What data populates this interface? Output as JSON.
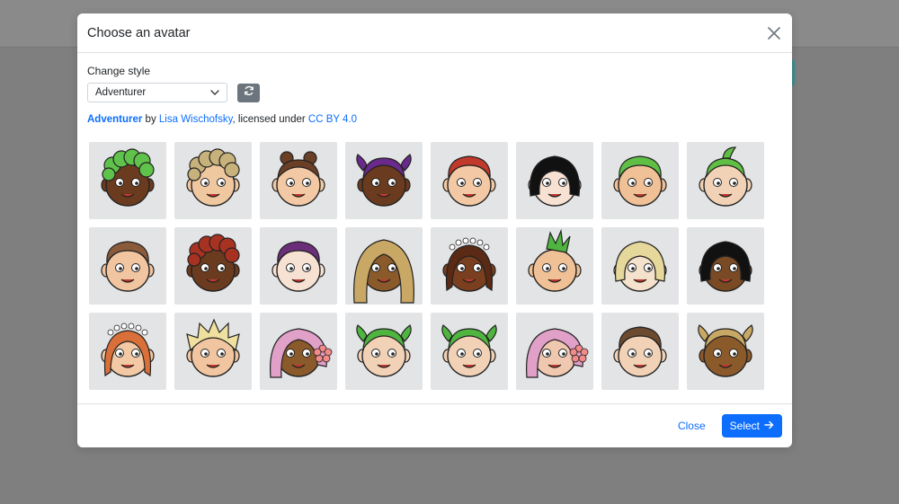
{
  "modal": {
    "title": "Choose an avatar",
    "change_style_label": "Change style",
    "style_select": {
      "selected": "Adventurer"
    },
    "credit": {
      "style_name": "Adventurer",
      "by_text": " by ",
      "author": "Lisa Wischofsky",
      "licensed_text": ", licensed under ",
      "license": "CC BY 4.0"
    },
    "footer": {
      "close_label": "Close",
      "select_label": "Select"
    }
  },
  "avatars": [
    {
      "skin": "#6b3b1f",
      "hair": "#5fc24a",
      "style": "curly"
    },
    {
      "skin": "#f0c8a0",
      "hair": "#c8b27c",
      "style": "curly"
    },
    {
      "skin": "#f2c9a4",
      "hair": "#6b3f26",
      "style": "buns"
    },
    {
      "skin": "#6b3b1f",
      "hair": "#6a2a8c",
      "style": "pigtails"
    },
    {
      "skin": "#f2c9a4",
      "hair": "#c0392b",
      "style": "short"
    },
    {
      "skin": "#f6e1d3",
      "hair": "#111111",
      "style": "bob"
    },
    {
      "skin": "#f0c096",
      "hair": "#5fbf45",
      "style": "short"
    },
    {
      "skin": "#f2d2b6",
      "hair": "#5fbf45",
      "style": "tuft"
    },
    {
      "skin": "#f0c59f",
      "hair": "#8a5a3b",
      "style": "short"
    },
    {
      "skin": "#6b3b1f",
      "hair": "#a83222",
      "style": "curly"
    },
    {
      "skin": "#f6e1d3",
      "hair": "#6b2f7a",
      "style": "short"
    },
    {
      "skin": "#8b5a2b",
      "hair": "#c9a865",
      "style": "long"
    },
    {
      "skin": "#7a3f1f",
      "hair": "#5a2a14",
      "style": "crown"
    },
    {
      "skin": "#f0c096",
      "hair": "#4fb540",
      "style": "mohawk"
    },
    {
      "skin": "#f4e2cc",
      "hair": "#e6d89a",
      "style": "bob"
    },
    {
      "skin": "#7a4a24",
      "hair": "#111111",
      "style": "bob"
    },
    {
      "skin": "#f2c9a4",
      "hair": "#d9703a",
      "style": "crown"
    },
    {
      "skin": "#f0c59f",
      "hair": "#efe0a0",
      "style": "spiky"
    },
    {
      "skin": "#8b5a2b",
      "hair": "#e0a0c8",
      "style": "flower"
    },
    {
      "skin": "#f2d2b6",
      "hair": "#4fb540",
      "style": "pigtails"
    },
    {
      "skin": "#f2d2b6",
      "hair": "#4fb540",
      "style": "pigtails"
    },
    {
      "skin": "#f0c8b0",
      "hair": "#e0a0c8",
      "style": "flower"
    },
    {
      "skin": "#f2d2b6",
      "hair": "#6b4a30",
      "style": "short"
    },
    {
      "skin": "#8b5a2b",
      "hair": "#c9a865",
      "style": "pigtails"
    }
  ]
}
